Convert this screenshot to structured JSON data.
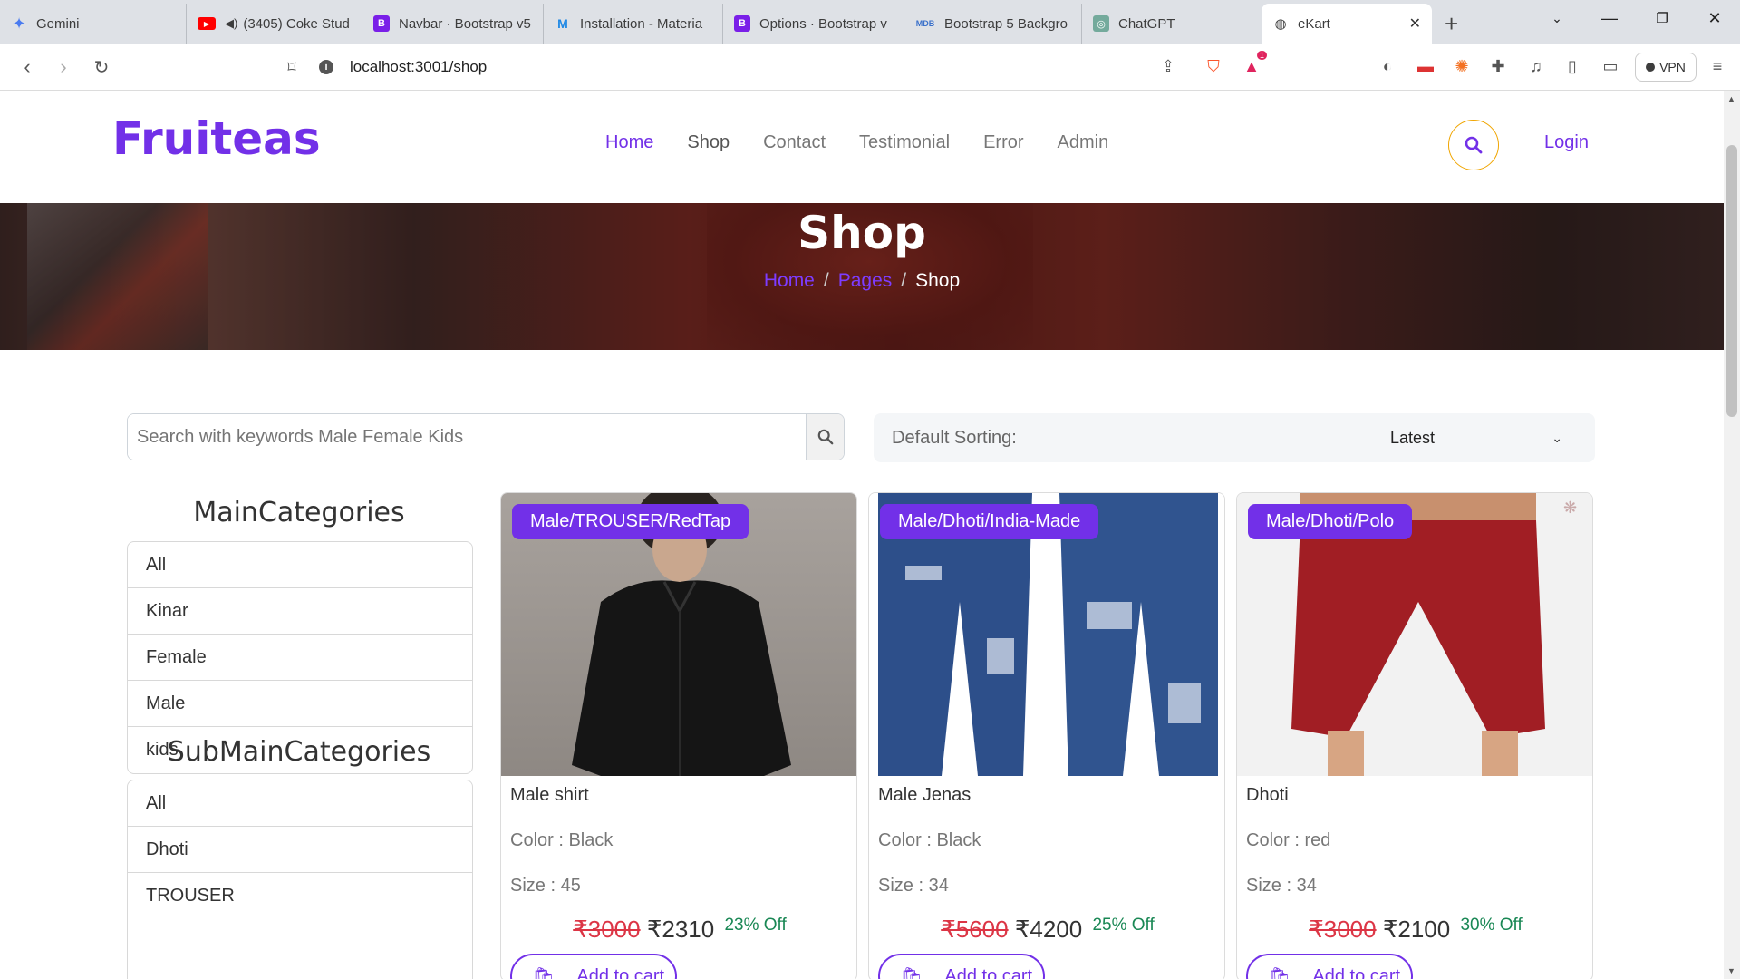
{
  "browser": {
    "tabs": [
      {
        "title": "Gemini",
        "icon": "gemini-icon"
      },
      {
        "title": "(3405) Coke Stud",
        "icon": "youtube-icon"
      },
      {
        "title": "Navbar · Bootstrap v5",
        "icon": "bootstrap-icon"
      },
      {
        "title": "Installation - Materia",
        "icon": "mui-icon"
      },
      {
        "title": "Options · Bootstrap v",
        "icon": "bootstrap-icon"
      },
      {
        "title": "Bootstrap 5 Backgro",
        "icon": "mdb-icon"
      },
      {
        "title": "ChatGPT",
        "icon": "chatgpt-icon"
      },
      {
        "title": "eKart",
        "icon": "globe-icon"
      }
    ],
    "url": "localhost:3001/shop",
    "vpn_label": "VPN",
    "notification_count": "1"
  },
  "navbar": {
    "brand": "Fruiteas",
    "links": [
      "Home",
      "Shop",
      "Contact",
      "Testimonial",
      "Error",
      "Admin"
    ],
    "login": "Login"
  },
  "hero": {
    "title": "Shop",
    "breadcrumb": [
      "Home",
      "Pages",
      "Shop"
    ]
  },
  "search": {
    "placeholder": "Search with keywords Male Female Kids"
  },
  "sorting": {
    "label": "Default Sorting:",
    "selected": "Latest"
  },
  "sidebar": {
    "main_title": "MainCategories",
    "main_items": [
      "All",
      "Kinar",
      "Female",
      "Male",
      "kids"
    ],
    "sub_title": "SubMainCategories",
    "sub_items": [
      "All",
      "Dhoti",
      "TROUSER"
    ]
  },
  "products": [
    {
      "badge": "Male/TROUSER/RedTap",
      "name": "Male shirt",
      "color": "Color : Black",
      "size": "Size : 45",
      "old_price": "₹3000",
      "price": "₹2310",
      "discount": "23% Off",
      "cart_label": "Add to cart"
    },
    {
      "badge": "Male/Dhoti/India-Made",
      "name": "Male Jenas",
      "color": "Color : Black",
      "size": "Size : 34",
      "old_price": "₹5600",
      "price": "₹4200",
      "discount": "25% Off",
      "cart_label": "Add to cart"
    },
    {
      "badge": "Male/Dhoti/Polo",
      "name": "Dhoti",
      "color": "Color : red",
      "size": "Size : 34",
      "old_price": "₹3000",
      "price": "₹2100",
      "discount": "30% Off",
      "cart_label": "Add to cart"
    }
  ],
  "colors": {
    "accent": "#7230e8",
    "search_ring": "#f0a500",
    "old_price": "#dc3545",
    "discount": "#198754"
  }
}
